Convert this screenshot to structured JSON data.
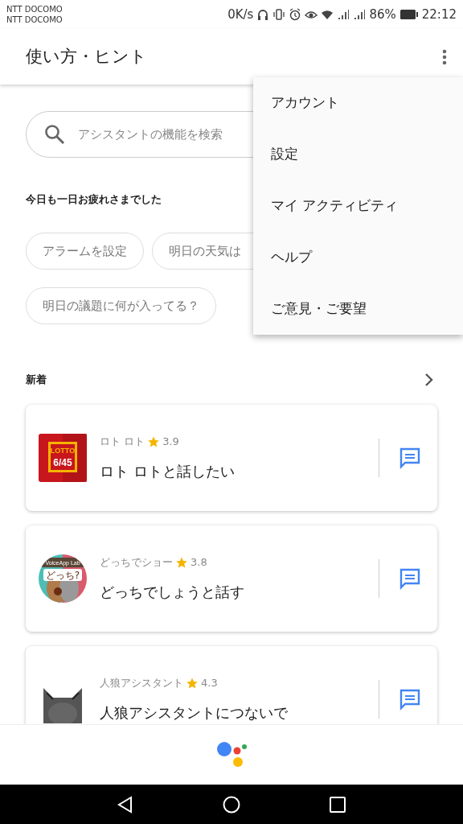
{
  "status_bar": {
    "carriers": [
      "NTT DOCOMO",
      "NTT DOCOMO"
    ],
    "speed": "0K/s",
    "battery": "86%",
    "time": "22:12"
  },
  "app_bar": {
    "title": "使い方・ヒント"
  },
  "search": {
    "placeholder": "アシスタントの機能を検索"
  },
  "greeting": "今日も一日お疲れさまでした",
  "suggestions": [
    {
      "label": "アラームを設定"
    },
    {
      "label": "明日の天気は"
    },
    {
      "label": "明日の議題に何が入ってる？"
    }
  ],
  "section": {
    "title": "新着"
  },
  "apps": [
    {
      "kind": "lotto",
      "icon_text": [
        "LOTTO",
        "6/45"
      ],
      "name": "ロト ロト",
      "rating": "3.9",
      "title": "ロト ロトと話したい"
    },
    {
      "kind": "dogs",
      "icon_text": [
        "VoiceApp Lab",
        "どっち?"
      ],
      "name": "どっちでショー",
      "rating": "3.8",
      "title": "どっちでしょうと話す"
    },
    {
      "kind": "wolf",
      "name": "人狼アシスタント",
      "rating": "4.3",
      "title": "人狼アシスタントにつないで"
    }
  ],
  "menu": {
    "items": [
      "アカウント",
      "設定",
      "マイ アクティビティ",
      "ヘルプ",
      "ご意見・ご要望"
    ]
  }
}
